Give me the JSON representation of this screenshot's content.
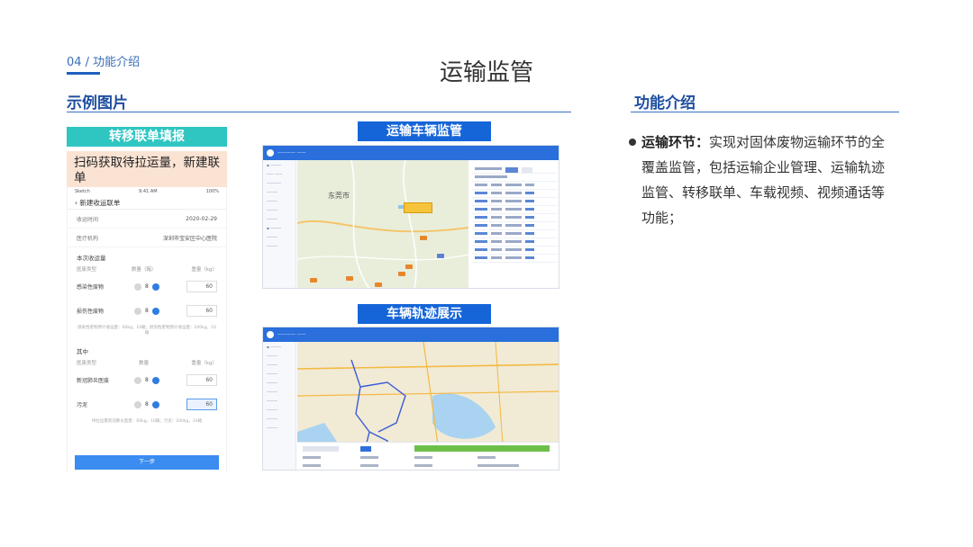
{
  "header": {
    "crumb": "04 / 功能介绍",
    "title": "运输监管"
  },
  "left_section": {
    "title": "示例图片"
  },
  "right_section": {
    "title": "功能介绍"
  },
  "phone_panel": {
    "banner": "转移联单填报",
    "note": "扫码获取待拉运量，新建联单",
    "status_left": "Sketch",
    "status_time": "9:41 AM",
    "status_right": "100%",
    "screen_title": "‹ 新建收运联单",
    "fields": [
      {
        "label": "收运时间",
        "value": "2020-02-29"
      },
      {
        "label": "医疗机构",
        "value": "深圳市宝安区中心医院"
      }
    ],
    "section1": "本次收运量",
    "section1_headers": [
      "医废类型",
      "数量（箱）",
      "重量（kg）"
    ],
    "items1": [
      {
        "name": "感染性废物",
        "count": "8",
        "weight": "60"
      },
      {
        "name": "损伤性废物",
        "count": "8",
        "weight": "60"
      }
    ],
    "hint1": "感染性废物预计收运量：60kg，10箱；损伤性废物预计收运量：200kg，10箱",
    "section2": "其中",
    "section2_headers": [
      "医废类型",
      "数量",
      "重量（kg）"
    ],
    "items2": [
      {
        "name": "新冠肺炎医废",
        "count": "8",
        "weight": "60"
      },
      {
        "name": "污泥",
        "count": "8",
        "weight": "60"
      }
    ],
    "hint2": "待拉运量新冠肺炎医废：60kg，10箱；污泥：200kg，10箱",
    "next_button": "下一步"
  },
  "screens": {
    "vehicle_caption": "运输车辆监管",
    "track_caption": "车辆轨迹展示",
    "city_label": "东莞市"
  },
  "description": {
    "lead": "运输环节：",
    "body": "实现对固体废物运输环节的全覆盖监管，包括运输企业管理、运输轨迹监管、转移联单、车载视频、视频通话等功能；"
  },
  "colors": {
    "accent": "#1565d8",
    "teal": "#2fc6c2",
    "note_bg": "#fbe3d3",
    "title_blue": "#1f4fa0"
  }
}
